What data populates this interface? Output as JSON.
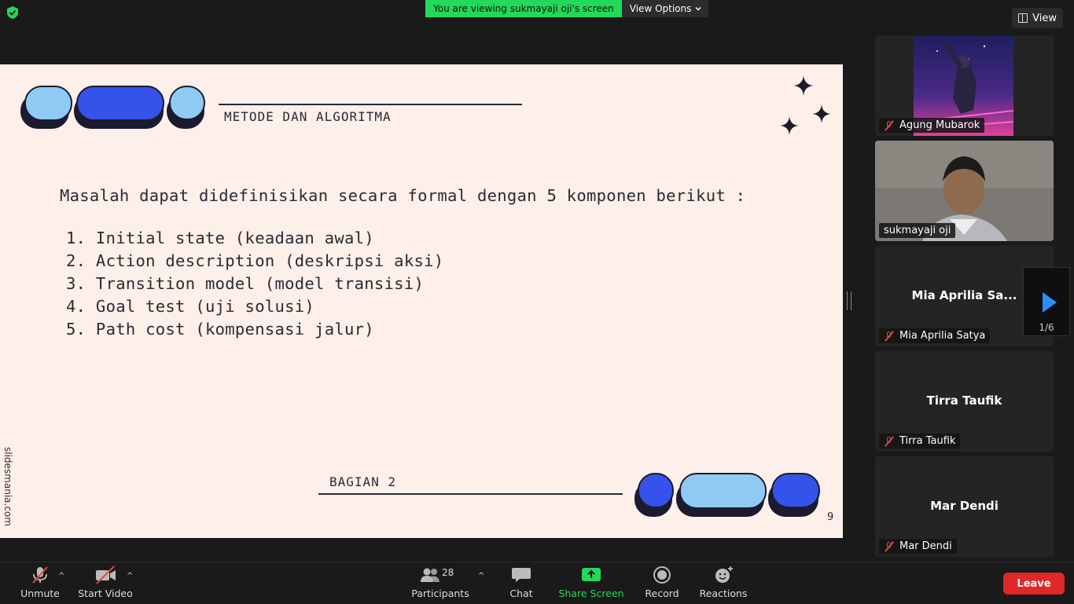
{
  "banner": {
    "viewing_text": "You are viewing sukmayaji oji's screen",
    "options_label": "View Options"
  },
  "view_button": {
    "label": "View"
  },
  "slide": {
    "title": "METODE DAN ALGORITMA",
    "intro": "Masalah dapat didefinisikan secara formal dengan 5 komponen berikut :",
    "items": [
      "1. Initial state (keadaan awal)",
      "2. Action description (deskripsi aksi)",
      "3. Transition model (model transisi)",
      "4. Goal test (uji solusi)",
      "5. Path cost (kompensasi jalur)"
    ],
    "footer_label": "BAGIAN 2",
    "page_number": "9",
    "credit": "slidesmania.com"
  },
  "participants_gallery": [
    {
      "name": "Agung Mubarok",
      "muted": true,
      "display": "avatar"
    },
    {
      "name": "sukmayaji oji",
      "muted": false,
      "display": "video"
    },
    {
      "name": "Mia Aprilia Satya",
      "display_name": "Mia Aprilia Sa...",
      "muted": true
    },
    {
      "name": "Tirra Taufik",
      "display_name": "Tirra Taufik",
      "muted": true
    },
    {
      "name": "Mar Dendi",
      "display_name": "Mar Dendi",
      "muted": true
    }
  ],
  "gallery_nav": {
    "page": "1/6"
  },
  "toolbar": {
    "unmute": "Unmute",
    "start_video": "Start Video",
    "participants": "Participants",
    "participants_count": "28",
    "chat": "Chat",
    "share_screen": "Share Screen",
    "record": "Record",
    "reactions": "Reactions",
    "leave": "Leave"
  },
  "colors": {
    "share_green": "#23d959",
    "leave_red": "#e02828",
    "accent_blue": "#2d8cff",
    "slide_bg": "#fdefe9"
  }
}
